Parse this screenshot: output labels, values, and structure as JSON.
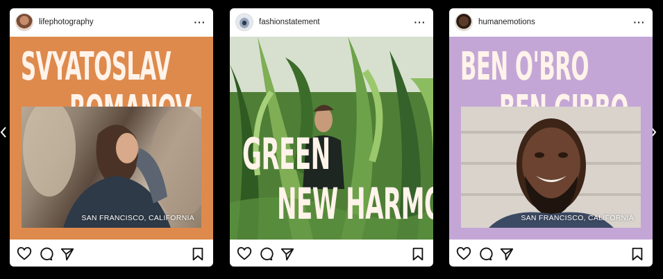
{
  "carousel": {
    "prev_icon": "chevron-left-icon",
    "next_icon": "chevron-right-icon"
  },
  "posts": [
    {
      "username": "lifephotography",
      "headline_1": "SVYATOSLAV",
      "headline_2": "ROMANOV",
      "location": "SAN FRANCISCO, CALIFORNIA",
      "background_color": "#de8a4d"
    },
    {
      "username": "fashionstatement",
      "headline_1": "GREEN",
      "headline_2": "NEW HARMONY",
      "background_color": "#3d6a2c"
    },
    {
      "username": "humanemotions",
      "headline_1": "BEN O'BRO",
      "headline_2": "BEN GIBBO",
      "location": "SAN FRANCISCO, CALIFORNIA",
      "background_color": "#c4a6d6"
    }
  ],
  "icons": {
    "more": "more-horizontal-icon",
    "like": "heart-icon",
    "comment": "comment-icon",
    "share": "send-icon",
    "save": "bookmark-icon"
  }
}
